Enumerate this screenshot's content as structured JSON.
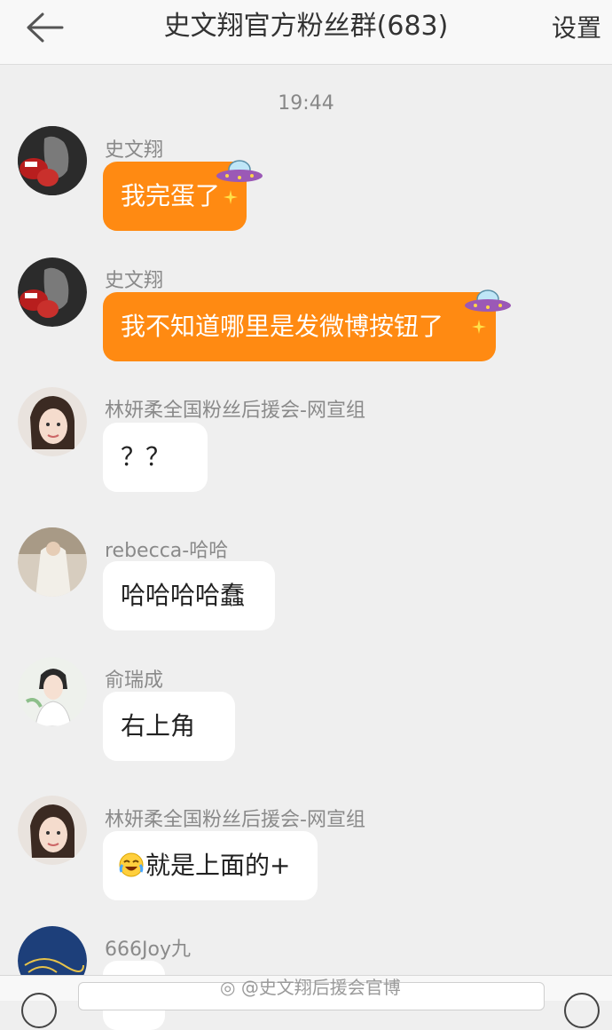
{
  "header": {
    "title": "史文翔官方粉丝群(683)",
    "settings_label": "设置"
  },
  "chat": {
    "timestamp": "19:44",
    "messages": [
      {
        "sender": "史文翔",
        "text": "我完蛋了",
        "style": "orange"
      },
      {
        "sender": "史文翔",
        "text": "我不知道哪里是发微博按钮了",
        "style": "orange"
      },
      {
        "sender": "林妍柔全国粉丝后援会-网宣组",
        "text": "？？",
        "style": "white"
      },
      {
        "sender": "rebecca-哈哈",
        "text": "哈哈哈哈蠢",
        "style": "white"
      },
      {
        "sender": "俞瑞成",
        "text": "右上角",
        "style": "white"
      },
      {
        "sender": "林妍柔全国粉丝后援会-网宣组",
        "text": "就是上面的+",
        "style": "white"
      },
      {
        "sender": "666Joy九",
        "text": "",
        "style": "white"
      }
    ]
  },
  "watermark": "@史文翔后援会官博",
  "colors": {
    "accent": "#ff8a12",
    "background": "#efefef"
  }
}
